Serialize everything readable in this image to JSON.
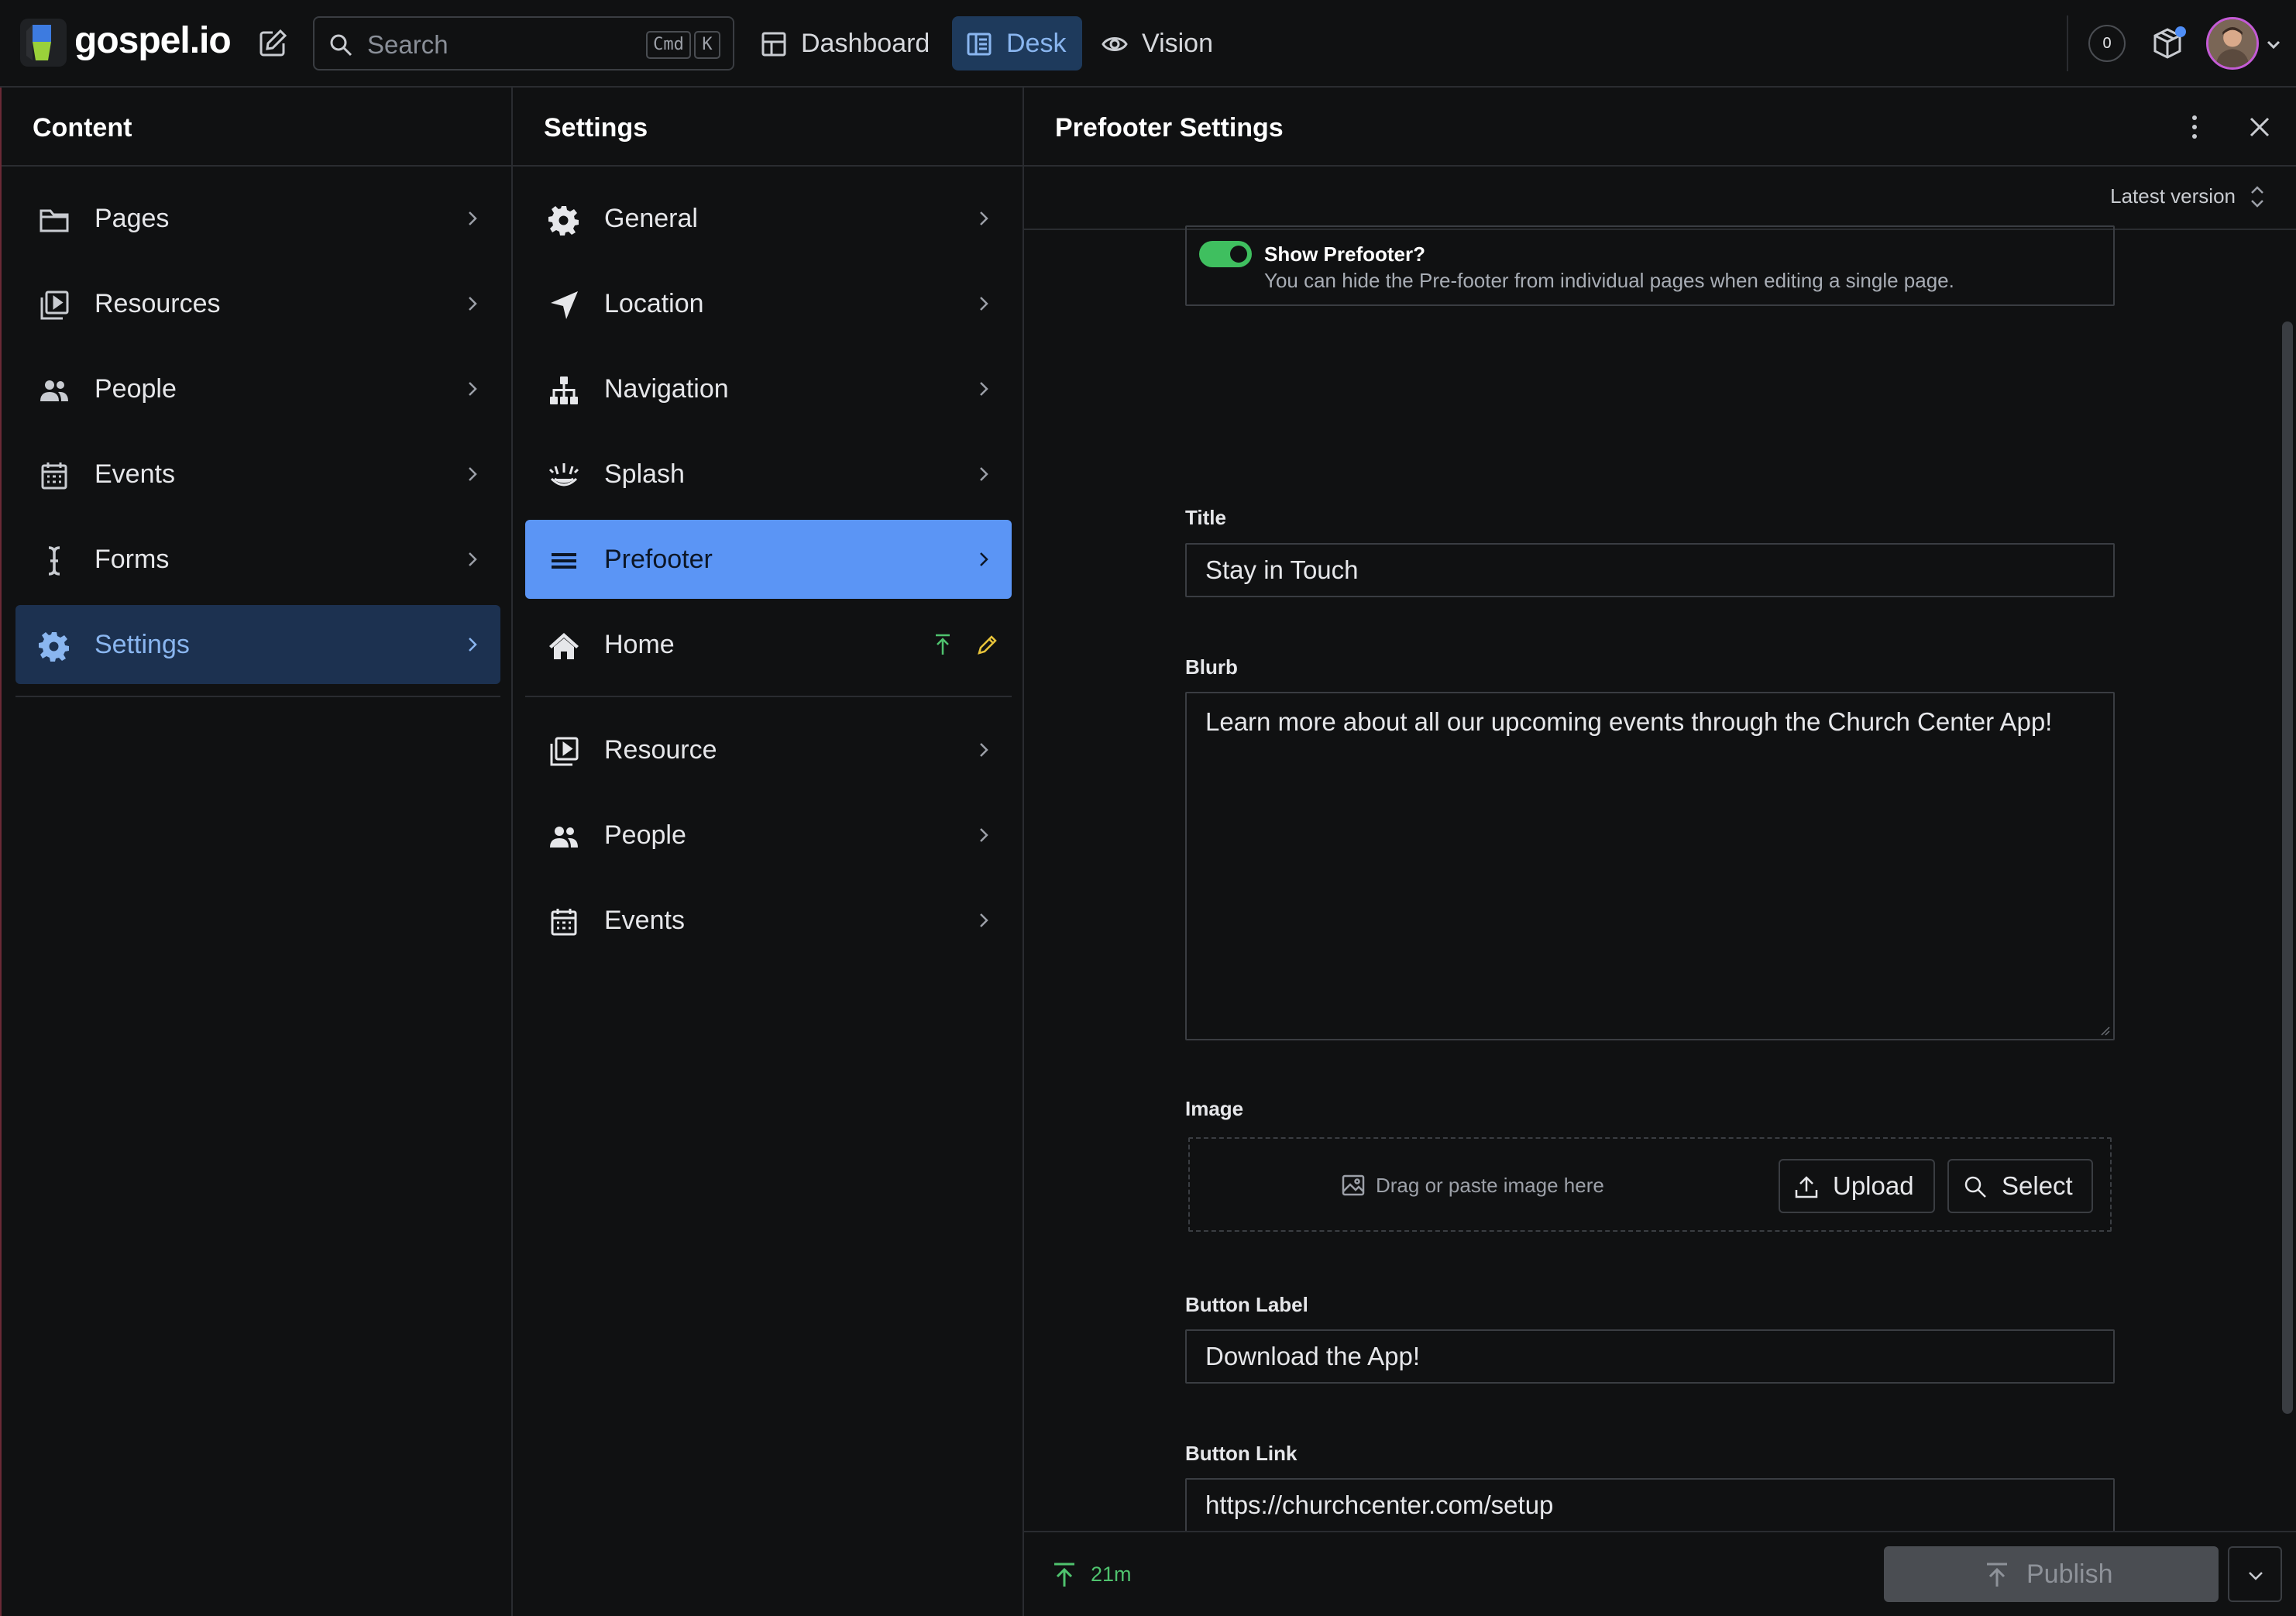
{
  "app": {
    "brand": "gospel.io",
    "search_placeholder": "Search",
    "search_kbd_cmd": "Cmd",
    "search_kbd_key": "K",
    "tabs": [
      {
        "label": "Dashboard",
        "icon": "dashboard-icon",
        "active": false
      },
      {
        "label": "Desk",
        "icon": "desk-icon",
        "active": true
      },
      {
        "label": "Vision",
        "icon": "eye-icon",
        "active": false
      }
    ],
    "notification_count": "0"
  },
  "content_pane": {
    "title": "Content",
    "items": [
      {
        "label": "Pages",
        "icon": "folder-icon"
      },
      {
        "label": "Resources",
        "icon": "resources-icon"
      },
      {
        "label": "People",
        "icon": "people-icon"
      },
      {
        "label": "Events",
        "icon": "calendar-icon"
      },
      {
        "label": "Forms",
        "icon": "text-cursor-icon"
      },
      {
        "label": "Settings",
        "icon": "gear-icon",
        "selected": true
      }
    ]
  },
  "settings_pane": {
    "title": "Settings",
    "items": [
      {
        "label": "General",
        "icon": "gear-icon"
      },
      {
        "label": "Location",
        "icon": "location-arrow-icon"
      },
      {
        "label": "Navigation",
        "icon": "sitemap-icon"
      },
      {
        "label": "Splash",
        "icon": "splash-icon"
      },
      {
        "label": "Prefooter",
        "icon": "prefooter-icon",
        "selected": true
      },
      {
        "label": "Home",
        "icon": "home-icon"
      }
    ],
    "items_secondary": [
      {
        "label": "Resource",
        "icon": "resources-icon"
      },
      {
        "label": "People",
        "icon": "people-icon"
      },
      {
        "label": "Events",
        "icon": "calendar-icon"
      }
    ]
  },
  "editor": {
    "title": "Prefooter Settings",
    "version_label": "Latest version",
    "toggle": {
      "title": "Show Prefooter?",
      "description": "You can hide the Pre-footer from individual pages when editing a single page.",
      "on": true
    },
    "fields": {
      "title_label": "Title",
      "title_value": "Stay in Touch",
      "blurb_label": "Blurb",
      "blurb_value": "Learn more about all our upcoming events through the Church Center App!",
      "image_label": "Image",
      "image_drop_text": "Drag or paste image here",
      "upload_label": "Upload",
      "select_label": "Select",
      "button_label_label": "Button Label",
      "button_label_value": "Download the App!",
      "button_link_label": "Button Link",
      "button_link_value": "https://churchcenter.com/setup"
    },
    "footer": {
      "published_ago": "21m",
      "publish_label": "Publish"
    }
  },
  "colors": {
    "accent_blue": "#5b95f5",
    "selected_dark": "#1c3150",
    "toggle_green": "#3fbf5f",
    "status_green": "#4fc36e"
  }
}
